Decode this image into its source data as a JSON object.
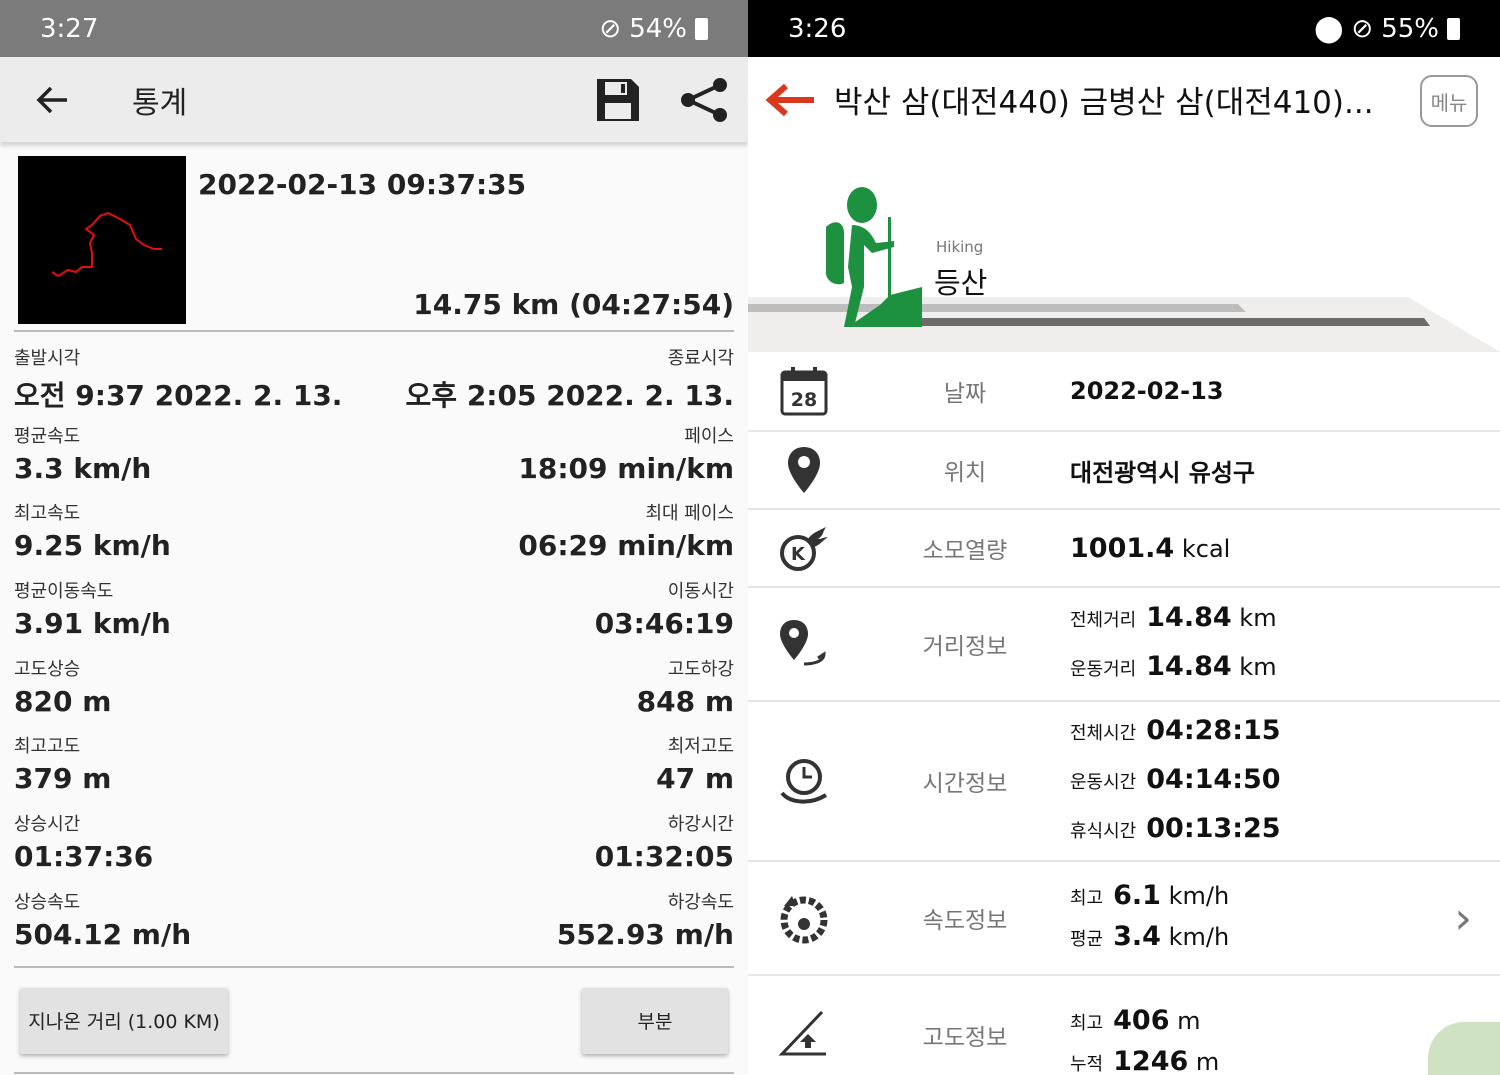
{
  "left": {
    "status": {
      "time": "3:27",
      "battery": "54%"
    },
    "toolbar": {
      "title": "통계"
    },
    "summary": {
      "datetime": "2022-02-13 09:37:35",
      "total": "14.75 km (04:27:54)"
    },
    "stats": [
      {
        "l_label": "출발시각",
        "l_value": "오전 9:37 2022. 2. 13.",
        "r_label": "종료시각",
        "r_value": "오후 2:05 2022. 2. 13."
      },
      {
        "l_label": "평균속도",
        "l_value": "3.3 km/h",
        "r_label": "페이스",
        "r_value": "18:09 min/km"
      },
      {
        "l_label": "최고속도",
        "l_value": "9.25 km/h",
        "r_label": "최대 페이스",
        "r_value": "06:29 min/km"
      },
      {
        "l_label": "평균이동속도",
        "l_value": "3.91 km/h",
        "r_label": "이동시간",
        "r_value": "03:46:19"
      },
      {
        "l_label": "고도상승",
        "l_value": "820 m",
        "r_label": "고도하강",
        "r_value": "848 m"
      },
      {
        "l_label": "최고고도",
        "l_value": "379 m",
        "r_label": "최저고도",
        "r_value": "47 m"
      },
      {
        "l_label": "상승시간",
        "l_value": "01:37:36",
        "r_label": "하강시간",
        "r_value": "01:32:05"
      },
      {
        "l_label": "상승속도",
        "l_value": "504.12 m/h",
        "r_label": "하강속도",
        "r_value": "552.93 m/h"
      }
    ],
    "buttons": {
      "distance": "지나온 거리 (1.00  KM)",
      "partial": "부분"
    }
  },
  "right": {
    "status": {
      "time": "3:26",
      "battery": "55%"
    },
    "header": {
      "title": "박산 삼(대전440) 금병산 삼(대전410)...",
      "menu": "메뉴"
    },
    "hero": {
      "activity_en": "Hiking",
      "activity_ko": "등산"
    },
    "date": {
      "label": "날짜",
      "value": "2022-02-13",
      "icon_day": "28"
    },
    "location": {
      "label": "위치",
      "value": "대전광역시 유성구"
    },
    "calories": {
      "label": "소모열량",
      "value": "1001.4",
      "unit": "kcal"
    },
    "distance": {
      "label": "거리정보",
      "total_label": "전체거리",
      "total": "14.84",
      "exercise_label": "운동거리",
      "exercise": "14.84",
      "unit": "km"
    },
    "time": {
      "label": "시간정보",
      "total_label": "전체시간",
      "total": "04:28:15",
      "exercise_label": "운동시간",
      "exercise": "04:14:50",
      "rest_label": "휴식시간",
      "rest": "00:13:25"
    },
    "speed": {
      "label": "속도정보",
      "max_label": "최고",
      "max": "6.1",
      "avg_label": "평균",
      "avg": "3.4",
      "unit": "km/h"
    },
    "altitude": {
      "label": "고도정보",
      "max_label": "최고",
      "max": "406",
      "cum_label": "누적",
      "cum": "1246",
      "unit": "m"
    }
  },
  "colors": {
    "accent_red": "#d9381e",
    "hiking_green": "#1e9140"
  }
}
